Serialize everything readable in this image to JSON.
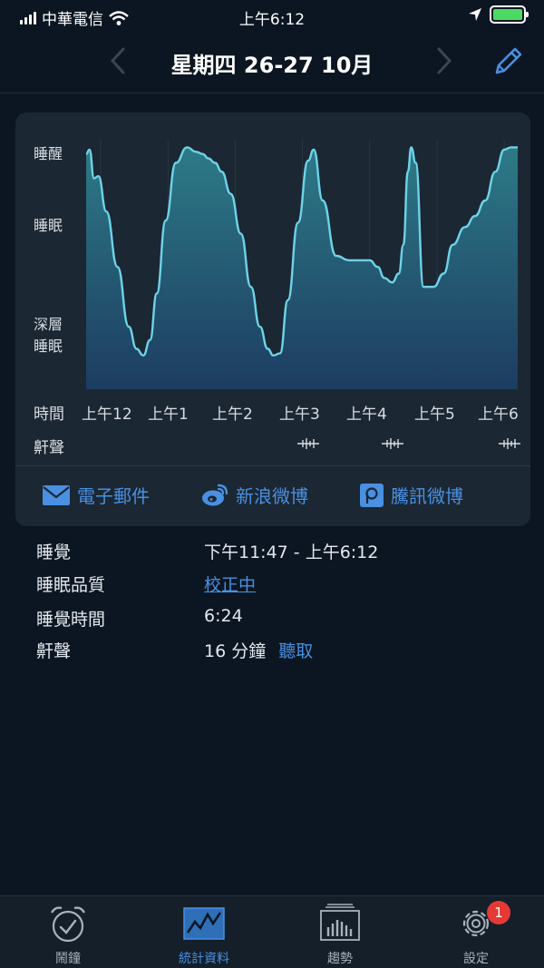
{
  "status_bar": {
    "carrier": "中華電信",
    "time": "上午6:12"
  },
  "header": {
    "title": "星期四 26-27 10月"
  },
  "chart": {
    "y_labels": {
      "awake": "睡醒",
      "sleep": "睡眠",
      "deep_line1": "深層",
      "deep_line2": "睡眠"
    },
    "x_axis_label": "時間",
    "x_ticks": [
      "上午12",
      "上午1",
      "上午2",
      "上午3",
      "上午4",
      "上午5",
      "上午6"
    ],
    "snore_label": "鼾聲"
  },
  "chart_data": {
    "type": "area",
    "xlabel": "時間",
    "y_categories": [
      "深層睡眠",
      "睡眠",
      "睡醒"
    ],
    "ylim": [
      0,
      1
    ],
    "x": [
      "23:47",
      "23:50",
      "23:54",
      "23:58",
      "00:05",
      "00:15",
      "00:25",
      "00:32",
      "00:38",
      "00:44",
      "00:50",
      "00:58",
      "01:07",
      "01:17",
      "01:25",
      "01:31",
      "01:36",
      "01:42",
      "01:48",
      "01:56",
      "02:05",
      "02:14",
      "02:22",
      "02:29",
      "02:34",
      "02:40",
      "02:47",
      "02:56",
      "03:05",
      "03:10",
      "03:18",
      "03:30",
      "03:42",
      "03:52",
      "04:00",
      "04:07",
      "04:13",
      "04:20",
      "04:26",
      "04:30",
      "04:34",
      "04:37",
      "04:41",
      "04:48",
      "04:57",
      "05:06",
      "05:14",
      "05:25",
      "05:34",
      "05:43",
      "05:52",
      "06:00",
      "06:06",
      "06:12"
    ],
    "values": [
      0.96,
      0.98,
      0.85,
      0.86,
      0.7,
      0.45,
      0.18,
      0.08,
      0.05,
      0.12,
      0.33,
      0.66,
      0.92,
      0.99,
      0.97,
      0.96,
      0.94,
      0.92,
      0.88,
      0.78,
      0.6,
      0.36,
      0.18,
      0.08,
      0.05,
      0.06,
      0.3,
      0.65,
      0.93,
      0.98,
      0.75,
      0.5,
      0.48,
      0.48,
      0.48,
      0.45,
      0.4,
      0.38,
      0.42,
      0.55,
      0.88,
      0.99,
      0.92,
      0.36,
      0.36,
      0.42,
      0.55,
      0.63,
      0.68,
      0.75,
      0.88,
      0.98,
      0.99,
      0.99
    ],
    "snore_marks": [
      "03:05",
      "04:20",
      "06:05"
    ]
  },
  "share": {
    "email": "電子郵件",
    "weibo": "新浪微博",
    "tencent": "騰訊微博"
  },
  "details": {
    "sleep_label": "睡覺",
    "sleep_value": "下午11:47 - 上午6:12",
    "quality_label": "睡眠品質",
    "quality_value": "校正中",
    "duration_label": "睡覺時間",
    "duration_value": "6:24",
    "snore_label": "鼾聲",
    "snore_value": "16 分鐘",
    "listen_label": "聽取"
  },
  "tabs": [
    {
      "label": "鬧鐘"
    },
    {
      "label": "統計資料"
    },
    {
      "label": "趨勢"
    },
    {
      "label": "設定",
      "badge": "1"
    }
  ],
  "colors": {
    "accent": "#4a90e2",
    "line": "#6ed3e8",
    "badge": "#e53935"
  }
}
